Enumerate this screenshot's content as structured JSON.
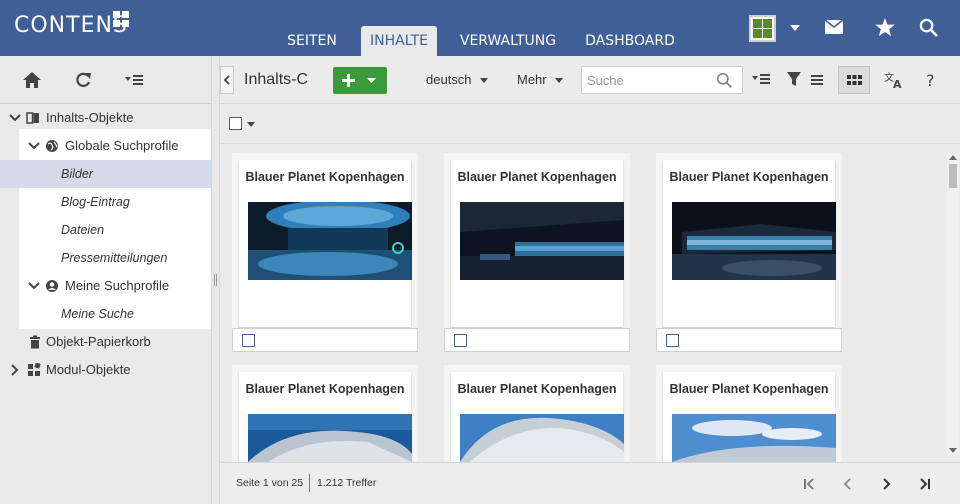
{
  "app": {
    "logo": "CONTENS"
  },
  "nav": {
    "tabs": [
      {
        "label": "SEITEN"
      },
      {
        "label": "INHALTE",
        "active": true
      },
      {
        "label": "VERWALTUNG"
      },
      {
        "label": "DASHBOARD"
      }
    ]
  },
  "header_icons": [
    "user-grid-icon",
    "chevron-down-icon",
    "mail-icon",
    "star-icon",
    "search-icon"
  ],
  "sidebar": {
    "toolbar_icons": [
      "home-icon",
      "refresh-icon",
      "list-menu-icon"
    ],
    "tree": {
      "root": "Inhalts-Objekte",
      "global_profiles": "Globale Suchprofile",
      "global_items": [
        "Bilder",
        "Blog-Eintrag",
        "Dateien",
        "Pressemitteilungen"
      ],
      "my_profiles": "Meine Suchprofile",
      "my_items": [
        "Meine Suche"
      ],
      "trash": "Objekt-Papierkorb",
      "modules": "Modul-Objekte"
    }
  },
  "toolbar": {
    "title": "Inhalts-C",
    "language": "deutsch",
    "more": "Mehr",
    "search_placeholder": "Suche"
  },
  "cards": [
    {
      "title": "Blauer Planet Kopenhagen"
    },
    {
      "title": "Blauer Planet Kopenhagen"
    },
    {
      "title": "Blauer Planet Kopenhagen"
    },
    {
      "title": "Blauer Planet Kopenhagen"
    },
    {
      "title": "Blauer Planet Kopenhagen"
    },
    {
      "title": "Blauer Planet Kopenhagen"
    }
  ],
  "status": {
    "page": "Seite 1 von 25",
    "hits": "1.212 Treffer"
  },
  "colors": {
    "header": "#3f5f96",
    "add_button": "#3c9a3a",
    "selected_row": "#d6dbea"
  }
}
